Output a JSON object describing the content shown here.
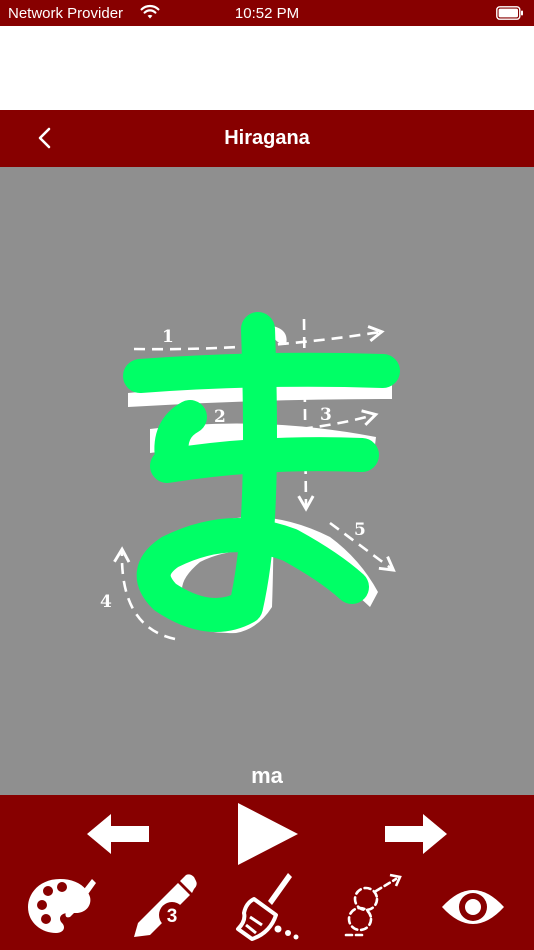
{
  "status_bar": {
    "carrier": "Network Provider",
    "time": "10:52 PM"
  },
  "nav": {
    "title": "Hiragana",
    "back_icon": "chevron-left-icon"
  },
  "lesson": {
    "character": "ま",
    "romaji": "ma",
    "stroke_numbers": [
      "1",
      "2",
      "3",
      "4",
      "5"
    ],
    "drawn_stroke_color": "#00ff66"
  },
  "toolbar": {
    "pencil_size": "3",
    "icons": [
      "arrow-left-icon",
      "play-icon",
      "arrow-right-icon",
      "palette-icon",
      "pencil-icon",
      "broom-icon",
      "trace-guide-icon",
      "eye-icon"
    ]
  },
  "colors": {
    "brand": "#870000",
    "canvas": "#8f8f8f",
    "accent": "#00ff66"
  }
}
